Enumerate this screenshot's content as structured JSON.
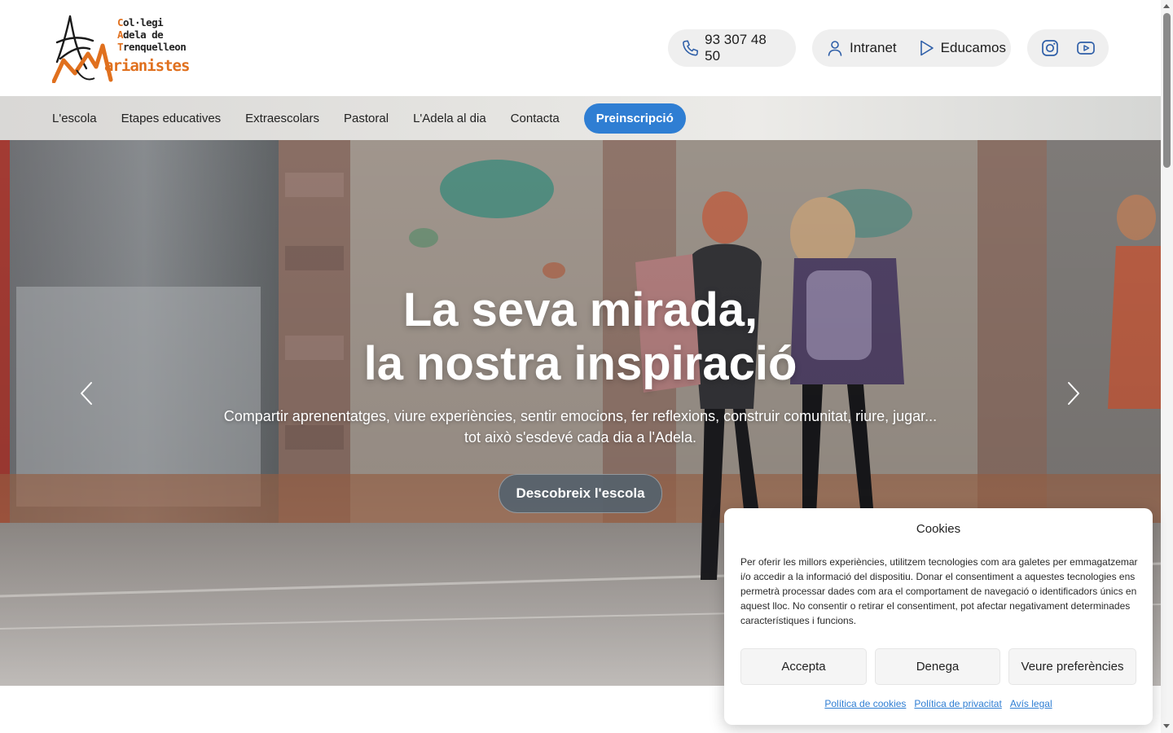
{
  "logo": {
    "line1": "Col·legi",
    "line2": "Adela de",
    "line3": "Trenquelleon",
    "line4": "arianistes"
  },
  "header": {
    "phone": "93 307 48 50",
    "intranet": "Intranet",
    "educamos": "Educamos",
    "icons": [
      "phone-icon",
      "user-icon",
      "play-icon",
      "instagram-icon",
      "youtube-icon"
    ]
  },
  "nav": {
    "items": [
      "L'escola",
      "Etapes educatives",
      "Extraescolars",
      "Pastoral",
      "L'Adela al dia",
      "Contacta"
    ],
    "cta": "Preinscripció"
  },
  "hero": {
    "title_line1": "La seva mirada,",
    "title_line2": "la nostra inspiració",
    "subtitle": "Compartir aprenentatges, viure experiències, sentir emocions, fer reflexions, construir comunitat, riure, jugar... tot això s'esdevé cada dia a l'Adela.",
    "button": "Descobreix l'escola"
  },
  "cookies": {
    "title": "Cookies",
    "text": "Per oferir les millors experiències, utilitzem tecnologies com ara galetes per emmagatzemar i/o accedir a la informació del dispositiu. Donar el consentiment a aquestes tecnologies ens permetrà processar dades com ara el comportament de navegació o identificadors únics en aquest lloc. No consentir o retirar el consentiment, pot afectar negativament determinades característiques i funcions.",
    "accept": "Accepta",
    "deny": "Denega",
    "preferences": "Veure preferències",
    "links": [
      "Política de cookies",
      "Política de privacitat",
      "Avís legal"
    ]
  },
  "colors": {
    "accent_blue": "#2f7ed3",
    "logo_orange": "#e0701e",
    "pill_bg": "#efefef"
  }
}
